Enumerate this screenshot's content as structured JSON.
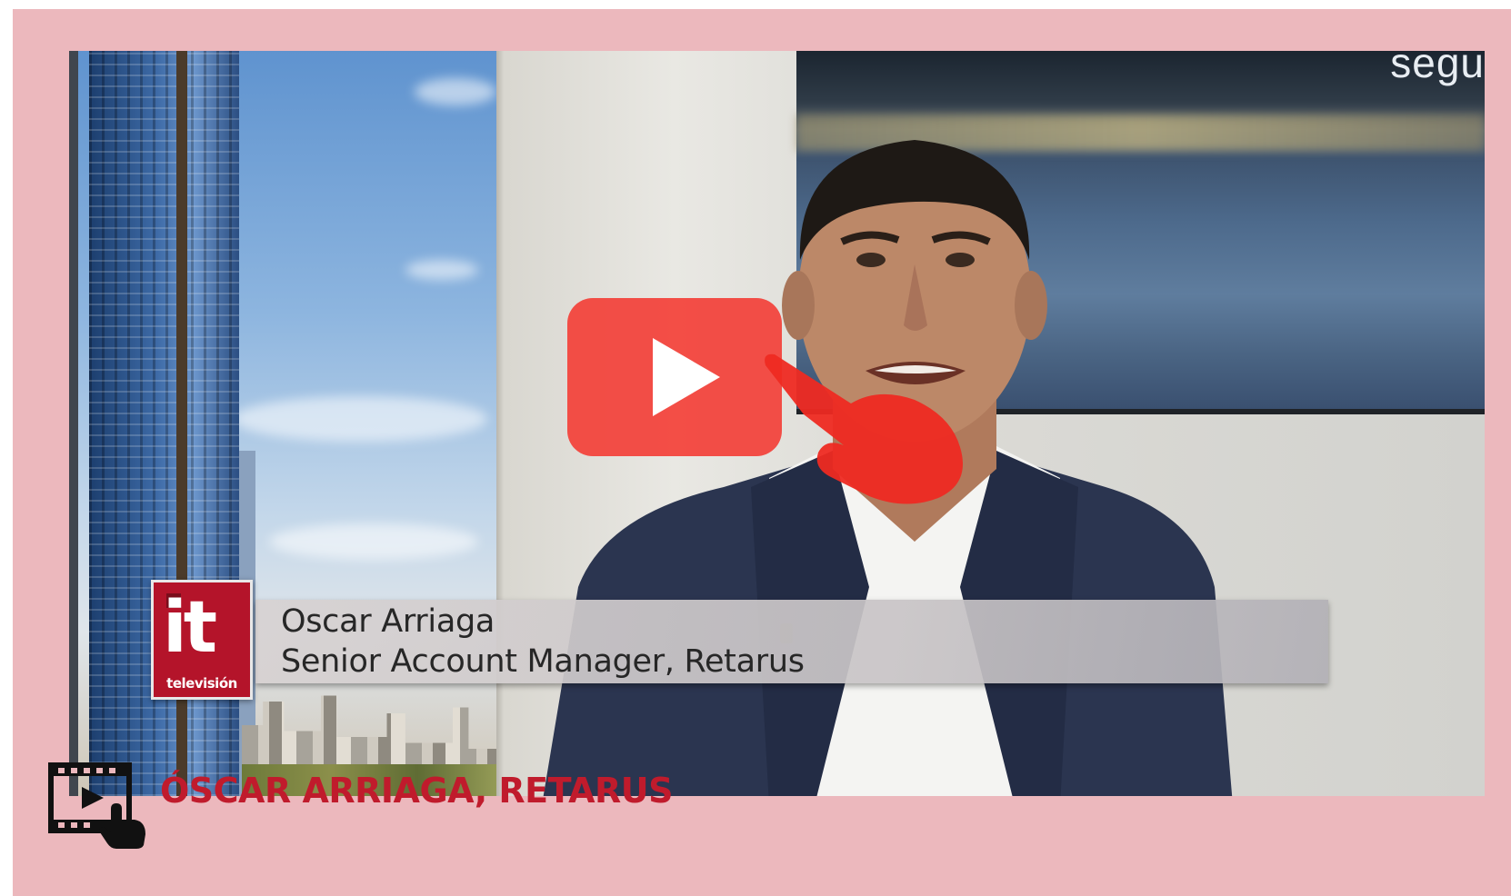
{
  "video": {
    "screen_text": "segu",
    "lower_third": {
      "name": "Oscar Arriaga",
      "role": "Senior Account Manager, Retarus"
    },
    "channel_logo": {
      "main": "it",
      "sub": "televisión"
    },
    "play_button_label": "Play video"
  },
  "caption": {
    "icon": "video-play-icon",
    "title": "ÓSCAR ARRIAGA, RETARUS"
  },
  "colors": {
    "card_background": "#ecb8bd",
    "accent_red": "#c01b2c",
    "play_button": "#f34038",
    "logo_red": "#b4142a"
  }
}
